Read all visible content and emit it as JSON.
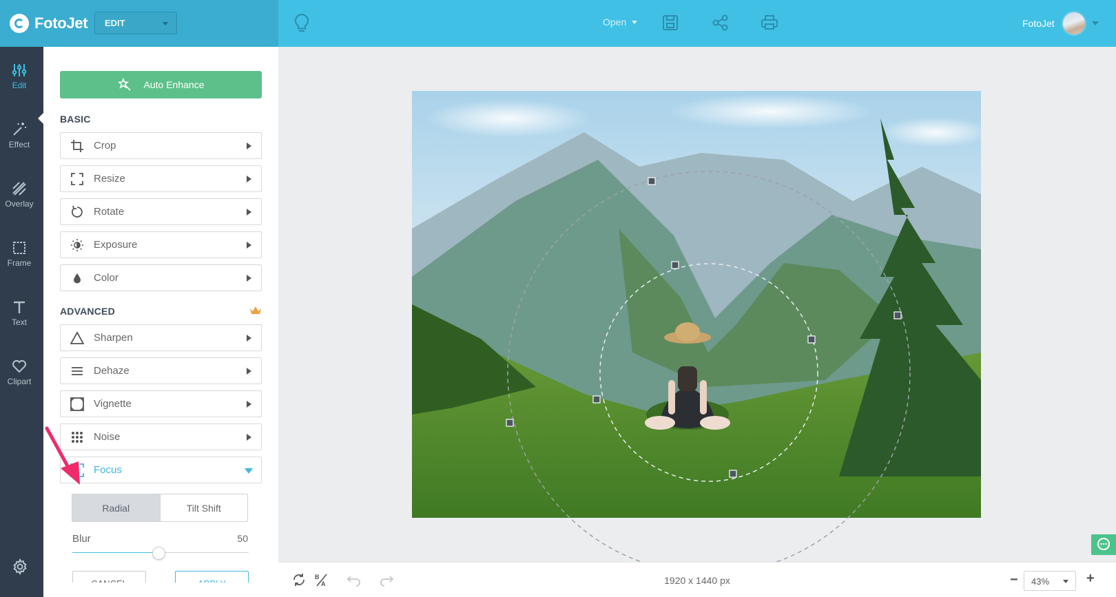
{
  "header": {
    "brand": "FotoJet",
    "mode_select": "EDIT",
    "open_label": "Open",
    "user_name": "FotoJet"
  },
  "rail": {
    "items": [
      {
        "label": "Edit",
        "icon": "sliders-icon"
      },
      {
        "label": "Effect",
        "icon": "magic-wand-icon"
      },
      {
        "label": "Overlay",
        "icon": "overlay-icon"
      },
      {
        "label": "Frame",
        "icon": "frame-icon"
      },
      {
        "label": "Text",
        "icon": "text-icon"
      },
      {
        "label": "Clipart",
        "icon": "heart-icon"
      }
    ]
  },
  "panel": {
    "auto_enhance": "Auto Enhance",
    "basic_title": "BASIC",
    "advanced_title": "ADVANCED",
    "basic_tools": [
      "Crop",
      "Resize",
      "Rotate",
      "Exposure",
      "Color"
    ],
    "advanced_tools": [
      "Sharpen",
      "Dehaze",
      "Vignette",
      "Noise",
      "Focus"
    ],
    "focus": {
      "modes": [
        "Radial",
        "Tilt Shift"
      ],
      "selected_mode": "Radial",
      "blur_label": "Blur",
      "blur_value": "50",
      "blur_fraction": 0.49,
      "cancel": "CANCEL",
      "apply": "APPLY"
    }
  },
  "canvas": {
    "dimensions": "1920 x 1440 px",
    "zoom": "43%"
  },
  "colors": {
    "accent": "#40c0e4",
    "rail_bg": "#2f3d4c",
    "enhance_green": "#5dc08a",
    "highlight_arrow": "#ef2b6c"
  }
}
